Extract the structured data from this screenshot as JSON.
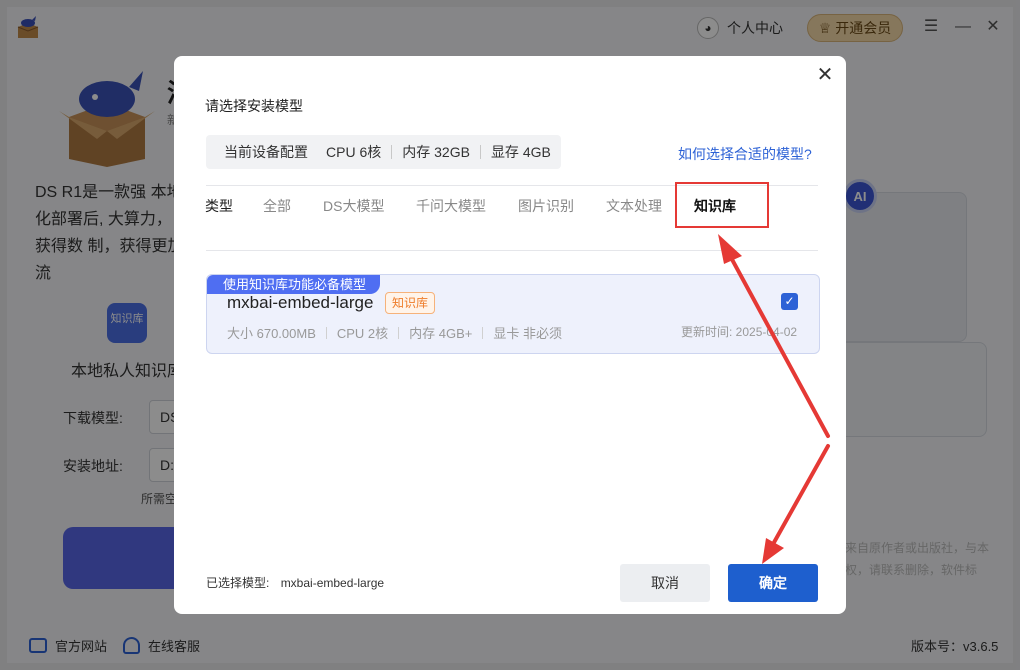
{
  "titlebar": {
    "user_center": "个人中心",
    "vip": "开通会员"
  },
  "background": {
    "hero_title": "满",
    "hero_sub": "新",
    "description": "DS R1是一款强 本地化部署后, 大算力，获得数 制，获得更加流",
    "kb_icon_text": "知识库",
    "kb_label": "本地私人知识库",
    "download_model_label": "下载模型:",
    "download_model_value": "DS",
    "install_path_label": "安装地址:",
    "install_path_value": "D:",
    "space_hint": "所需空",
    "ai_badge": "AI",
    "faint_line1": "来自原作者或出版社，与本",
    "faint_line2": "权，请联系删除，软件标"
  },
  "footer": {
    "website": "官方网站",
    "support": "在线客服",
    "version": "版本号：v3.6.5"
  },
  "modal": {
    "title": "请选择安装模型",
    "config": {
      "label": "当前设备配置",
      "cpu": "CPU 6核",
      "memory": "内存 32GB",
      "vram": "显存 4GB"
    },
    "help_link": "如何选择合适的模型?",
    "tabs": {
      "label": "类型",
      "items": [
        "全部",
        "DS大模型",
        "千问大模型",
        "图片识别",
        "文本处理",
        "知识库"
      ],
      "active": "知识库"
    },
    "model": {
      "ribbon": "使用知识库功能必备模型",
      "name": "mxbai-embed-large",
      "tag": "知识库",
      "size": "大小 670.00MB",
      "cpu": "CPU 2核",
      "memory": "内存 4GB+",
      "gpu": "显卡 非必须",
      "updated": "更新时间:  2025-04-02",
      "checked": true
    },
    "selected_label": "已选择模型:",
    "selected_value": "mxbai-embed-large",
    "cancel": "取消",
    "confirm": "确定"
  },
  "colors": {
    "primary": "#1e5fce",
    "accent": "#4f6ef2",
    "highlight": "#e53935",
    "tag": "#ef7d2a"
  }
}
